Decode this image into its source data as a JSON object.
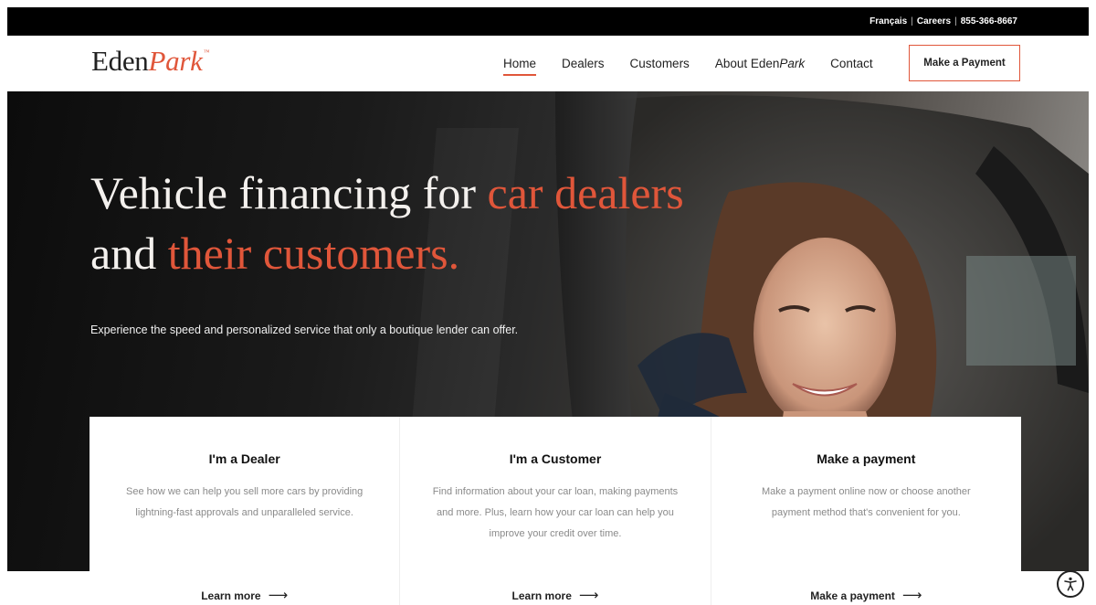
{
  "utility_bar": {
    "links": [
      "Français",
      "Careers",
      "855-366-8667"
    ]
  },
  "header": {
    "logo": {
      "part1": "Eden",
      "part2": "Park",
      "tm": "™"
    },
    "nav": [
      {
        "label": "Home",
        "active": true
      },
      {
        "label": "Dealers",
        "active": false
      },
      {
        "label": "Customers",
        "active": false
      },
      {
        "label_prefix": "About Eden",
        "label_italic": "Park",
        "active": false
      },
      {
        "label": "Contact",
        "active": false
      }
    ],
    "cta": "Make a Payment"
  },
  "hero": {
    "title_parts": {
      "t1": "Vehicle financing for ",
      "t2": "car dealers",
      "t3": " and ",
      "t4": "their customers."
    },
    "subtitle": "Experience the speed and personalized service that only a boutique lender can offer."
  },
  "cards": [
    {
      "title": "I'm a Dealer",
      "description": "See how we can help you sell more cars by providing lightning-fast approvals and unparalleled service.",
      "link": "Learn more"
    },
    {
      "title": "I'm a Customer",
      "description": "Find information about your car loan, making payments and more. Plus, learn how your car loan can help you improve your credit over time.",
      "link": "Learn more"
    },
    {
      "title": "Make a payment",
      "description": "Make a payment online now or choose another payment method that's convenient for you.",
      "link": "Make a payment"
    }
  ],
  "icons": {
    "arrow": "arrow-right-icon",
    "accessibility": "accessibility-icon"
  },
  "colors": {
    "accent": "#e0563a",
    "topbar": "#000000",
    "card_text": "#8a8a8a"
  }
}
